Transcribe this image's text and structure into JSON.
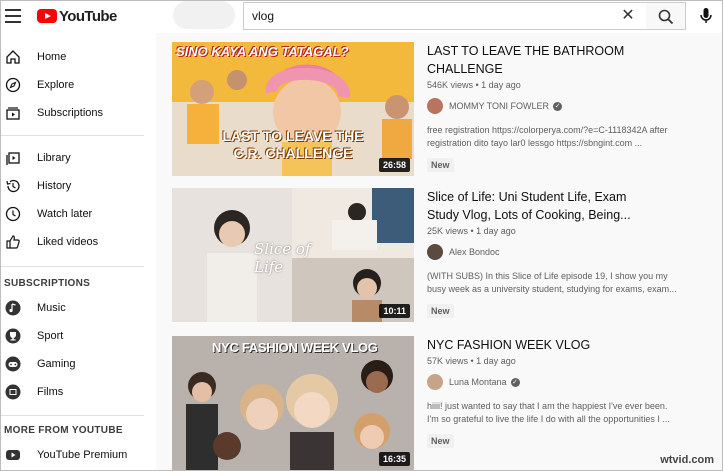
{
  "app": {
    "logo_text": "YouTube"
  },
  "search": {
    "value": "vlog"
  },
  "sidebar": {
    "main_items": [
      {
        "label": "Home",
        "icon": "home-icon"
      },
      {
        "label": "Explore",
        "icon": "compass-icon"
      },
      {
        "label": "Subscriptions",
        "icon": "subscriptions-icon"
      }
    ],
    "library_items": [
      {
        "label": "Library",
        "icon": "library-icon"
      },
      {
        "label": "History",
        "icon": "history-icon"
      },
      {
        "label": "Watch later",
        "icon": "clock-icon"
      },
      {
        "label": "Liked videos",
        "icon": "thumbs-up-icon"
      }
    ],
    "subscriptions_title": "SUBSCRIPTIONS",
    "subscriptions": [
      {
        "label": "Music",
        "icon": "music-icon"
      },
      {
        "label": "Sport",
        "icon": "trophy-icon"
      },
      {
        "label": "Gaming",
        "icon": "gamepad-icon"
      },
      {
        "label": "Films",
        "icon": "film-icon"
      }
    ],
    "more_title": "MORE FROM YOUTUBE",
    "more_items": [
      {
        "label": "YouTube Premium",
        "icon": "youtube-icon"
      }
    ]
  },
  "results": [
    {
      "title": "LAST TO LEAVE THE BATHROOM CHALLENGE",
      "meta": "546K views • 1 day ago",
      "channel": "MOMMY TONI FOWLER",
      "verified": true,
      "description": "free registration https://colorperya.com/?e=C-1118342A after registration dito tayo lar0 lessgo https://sbngint.com ...",
      "badge": "New",
      "duration": "26:58",
      "thumb_caption_top": "SINO KAYA ANG TATAGAL?",
      "thumb_caption_bottom": "LAST TO LEAVE THE C.R. CHALLENGE"
    },
    {
      "title": "Slice of Life: Uni Student Life, Exam Study Vlog, Lots of Cooking, Being...",
      "meta": "25K views • 1 day ago",
      "channel": "Alex Bondoc",
      "verified": false,
      "description": "(WITH SUBS) In this Slice of Life episode 19, I show you my busy week as a university student, studying for exams, exam...",
      "badge": "New",
      "duration": "10:11",
      "thumb_caption_top": "Slice of Life"
    },
    {
      "title": "NYC FASHION WEEK VLOG",
      "meta": "57K views • 1 day ago",
      "channel": "Luna Montana",
      "verified": true,
      "description": "hiiii! just wanted to say that I am the happiest I've ever been. I'm so grateful to live the life I do with all the opportunities I ...",
      "badge": "New",
      "duration": "16:35",
      "thumb_caption_top": "NYC FASHION WEEK VLOG"
    }
  ],
  "watermark": "wtvid.com",
  "colors": {
    "brand_red": "#ff0000",
    "sidebar_bg": "#ffffff",
    "content_bg": "#f9f9f9"
  }
}
